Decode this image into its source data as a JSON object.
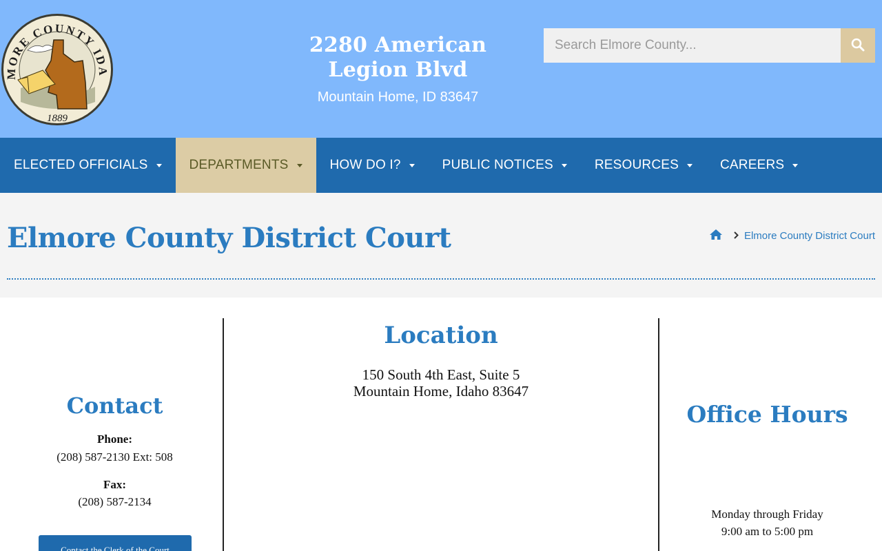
{
  "header": {
    "seal": {
      "top_text": "ELMORE COUNTY IDAHO",
      "year": "1889"
    },
    "address_line1": "2280 American Legion Blvd",
    "address_line2": "Mountain Home, ID 83647",
    "search": {
      "placeholder": "Search Elmore County..."
    }
  },
  "nav": {
    "items": [
      {
        "label": "ELECTED OFFICIALS"
      },
      {
        "label": "DEPARTMENTS"
      },
      {
        "label": "HOW DO I?"
      },
      {
        "label": "PUBLIC NOTICES"
      },
      {
        "label": "RESOURCES"
      },
      {
        "label": "CAREERS"
      }
    ]
  },
  "page": {
    "title": "Elmore County District Court",
    "breadcrumb": "Elmore County District Court"
  },
  "contact": {
    "heading": "Contact",
    "phone_label": "Phone:",
    "phone": "(208) 587-2130 Ext: 508",
    "fax_label": "Fax:",
    "fax": "(208) 587-2134",
    "button": "Contact the Clerk of the Court"
  },
  "location": {
    "heading": "Location",
    "line1": "150 South 4th East, Suite 5",
    "line2": "Mountain Home, Idaho 83647"
  },
  "hours": {
    "heading": "Office Hours",
    "days": "Monday through Friday",
    "times": "9:00 am to 5:00 pm"
  },
  "colors": {
    "header_bg": "#80b8fc",
    "nav_bg": "#1f6aad",
    "nav_active_bg": "#dccca5",
    "accent": "#2b7cc0"
  }
}
